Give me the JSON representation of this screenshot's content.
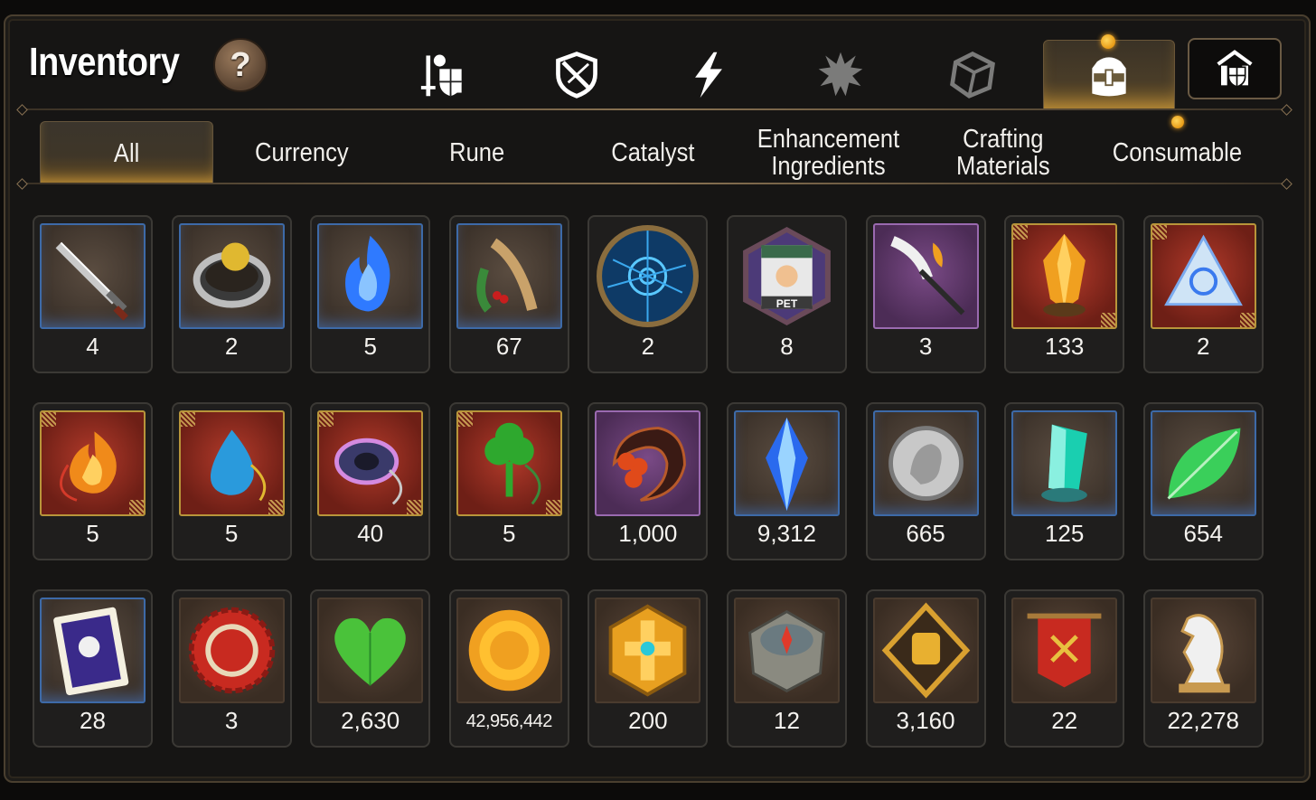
{
  "header": {
    "title": "Inventory",
    "help_label": "?"
  },
  "icon_tabs": [
    {
      "name": "tab-hero",
      "icon": "knight-sword-shield-icon",
      "active": false
    },
    {
      "name": "tab-equipment",
      "icon": "crossed-shield-icon",
      "active": false
    },
    {
      "name": "tab-lightning",
      "icon": "lightning-bolt-icon",
      "active": false
    },
    {
      "name": "tab-burst",
      "icon": "burst-icon",
      "active": false
    },
    {
      "name": "tab-cube",
      "icon": "cube-icon",
      "active": false
    },
    {
      "name": "tab-inventory",
      "icon": "backpack-icon",
      "active": true
    }
  ],
  "exit_icon": "guild-tower-icon",
  "categories": [
    {
      "label": "All",
      "active": true
    },
    {
      "label": "Currency",
      "active": false
    },
    {
      "label": "Rune",
      "active": false
    },
    {
      "label": "Catalyst",
      "active": false
    },
    {
      "label": "Enhancement\nIngredients",
      "active": false
    },
    {
      "label": "Crafting\nMaterials",
      "active": false
    },
    {
      "label": "Consumable",
      "active": false,
      "notify": true
    }
  ],
  "items": [
    {
      "icon": "sword-icon",
      "count": "4",
      "frame": "blue"
    },
    {
      "icon": "ring-icon",
      "count": "2",
      "frame": "blue"
    },
    {
      "icon": "blue-flame-icon",
      "count": "5",
      "frame": "blue"
    },
    {
      "icon": "root-herb-icon",
      "count": "67",
      "frame": "blue"
    },
    {
      "icon": "rune-circle-icon",
      "count": "2",
      "frame": "round"
    },
    {
      "icon": "pet-pack-icon",
      "count": "8",
      "frame": "round"
    },
    {
      "icon": "feather-staff-icon",
      "count": "3",
      "frame": "purple"
    },
    {
      "icon": "fire-crystal-icon",
      "count": "133",
      "frame": "gold"
    },
    {
      "icon": "triangle-crystal-icon",
      "count": "2",
      "frame": "gold"
    },
    {
      "icon": "fire-charm-icon",
      "count": "5",
      "frame": "gold"
    },
    {
      "icon": "water-charm-icon",
      "count": "5",
      "frame": "gold"
    },
    {
      "icon": "ring-charm-icon",
      "count": "40",
      "frame": "gold"
    },
    {
      "icon": "clover-charm-icon",
      "count": "5",
      "frame": "gold"
    },
    {
      "icon": "flower-crescent-icon",
      "count": "1,000",
      "frame": "purple"
    },
    {
      "icon": "blue-gem-icon",
      "count": "9,312",
      "frame": "blue"
    },
    {
      "icon": "silver-coin-icon",
      "count": "665",
      "frame": "blue"
    },
    {
      "icon": "teal-crystal-icon",
      "count": "125",
      "frame": "blue"
    },
    {
      "icon": "leaf-icon",
      "count": "654",
      "frame": "blue"
    },
    {
      "icon": "pet-card-icon",
      "count": "28",
      "frame": "blue"
    },
    {
      "icon": "bottle-cap-icon",
      "count": "3",
      "frame": "brown"
    },
    {
      "icon": "green-heart-icon",
      "count": "2,630",
      "frame": "brown"
    },
    {
      "icon": "gold-coin-icon",
      "count": "42,956,442",
      "frame": "brown"
    },
    {
      "icon": "gold-hexagon-icon",
      "count": "200",
      "frame": "brown"
    },
    {
      "icon": "compass-stone-icon",
      "count": "12",
      "frame": "brown"
    },
    {
      "icon": "fist-emblem-icon",
      "count": "3,160",
      "frame": "brown"
    },
    {
      "icon": "war-banner-icon",
      "count": "22",
      "frame": "brown"
    },
    {
      "icon": "chess-knight-icon",
      "count": "22,278",
      "frame": "brown"
    }
  ],
  "colors": {
    "accent_gold": "#f4a622",
    "frame_blue": "#3d6aa8",
    "frame_gold": "#b8953a",
    "frame_purple": "#9a6ab0"
  }
}
